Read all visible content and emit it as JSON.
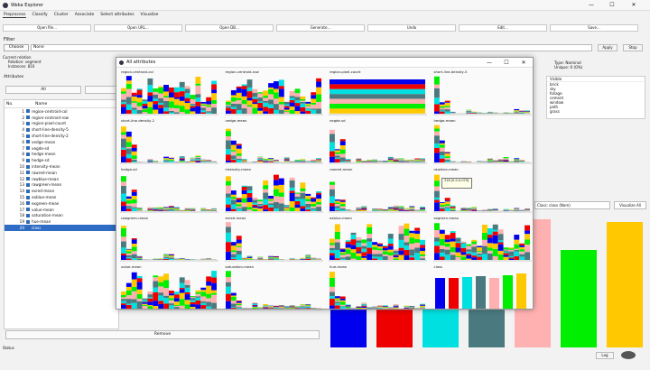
{
  "window": {
    "title": "Weka Explorer",
    "minimize": "—",
    "maximize": "☐",
    "close": "✕"
  },
  "tabs": [
    "Preprocess",
    "Classify",
    "Cluster",
    "Associate",
    "Select attributes",
    "Visualize"
  ],
  "toolbar": [
    "Open file...",
    "Open URL...",
    "Open DB...",
    "Generate...",
    "Undo",
    "Edit...",
    "Save..."
  ],
  "filter": {
    "label": "Filter",
    "choose": "Choose",
    "value": "None",
    "apply": "Apply",
    "stop": "Stop"
  },
  "current_relation": {
    "header": "Current relation",
    "relation": "Relation: segment",
    "instances": "Instances: 810"
  },
  "attributes": {
    "label": "Attributes",
    "all": "All",
    "col_no": "No.",
    "col_name": "Name",
    "rows": [
      {
        "no": "1",
        "name": "region-centroid-col"
      },
      {
        "no": "2",
        "name": "region-centroid-row"
      },
      {
        "no": "3",
        "name": "region-pixel-count"
      },
      {
        "no": "4",
        "name": "short-line-density-5"
      },
      {
        "no": "5",
        "name": "short-line-density-2"
      },
      {
        "no": "6",
        "name": "vedge-mean"
      },
      {
        "no": "7",
        "name": "vegde-sd"
      },
      {
        "no": "8",
        "name": "hedge-mean"
      },
      {
        "no": "9",
        "name": "hedge-sd"
      },
      {
        "no": "10",
        "name": "intensity-mean"
      },
      {
        "no": "11",
        "name": "rawred-mean"
      },
      {
        "no": "12",
        "name": "rawblue-mean"
      },
      {
        "no": "13",
        "name": "rawgreen-mean"
      },
      {
        "no": "14",
        "name": "exred-mean"
      },
      {
        "no": "15",
        "name": "exblue-mean"
      },
      {
        "no": "16",
        "name": "exgreen-mean"
      },
      {
        "no": "17",
        "name": "value-mean"
      },
      {
        "no": "18",
        "name": "saturation-mean"
      },
      {
        "no": "19",
        "name": "hue-mean"
      },
      {
        "no": "20",
        "name": "class"
      }
    ],
    "remove": "Remove"
  },
  "selected_attribute": {
    "type": "Type: Nominal",
    "unique": "Unique: 0 (0%)",
    "col_values": "Visible",
    "values": [
      "brick",
      "sky",
      "foliage",
      "cement",
      "window",
      "path",
      "grass"
    ]
  },
  "visualize": {
    "class_select": "Class: class (Nom)",
    "visualize_all": "Visualize All"
  },
  "status": {
    "label": "Status",
    "log": "Log"
  },
  "dialog": {
    "title": "All attributes",
    "minimize": "—",
    "maximize": "☐",
    "close": "✕",
    "panels": [
      "region-centroid-col",
      "region-centroid-row",
      "region-pixel-count",
      "short-line-density-5",
      "short-line-density-2",
      "vedge-mean",
      "vegde-sd",
      "hedge-mean",
      "hedge-sd",
      "intensity-mean",
      "rawred-mean",
      "rawblue-mean",
      "rawgreen-mean",
      "exred-mean",
      "exblue-mean",
      "exgreen-mean",
      "value-mean",
      "saturation-mean",
      "hue-mean",
      "class"
    ],
    "tooltip": "318 [0.0-0.079]"
  },
  "class_colors": [
    "#0000ee",
    "#ee0000",
    "#00e0e0",
    "#4a7a80",
    "#ffb0b0",
    "#00ee00",
    "#ffc800"
  ],
  "class_counts": [
    110,
    110,
    116,
    117,
    110,
    119,
    126
  ]
}
